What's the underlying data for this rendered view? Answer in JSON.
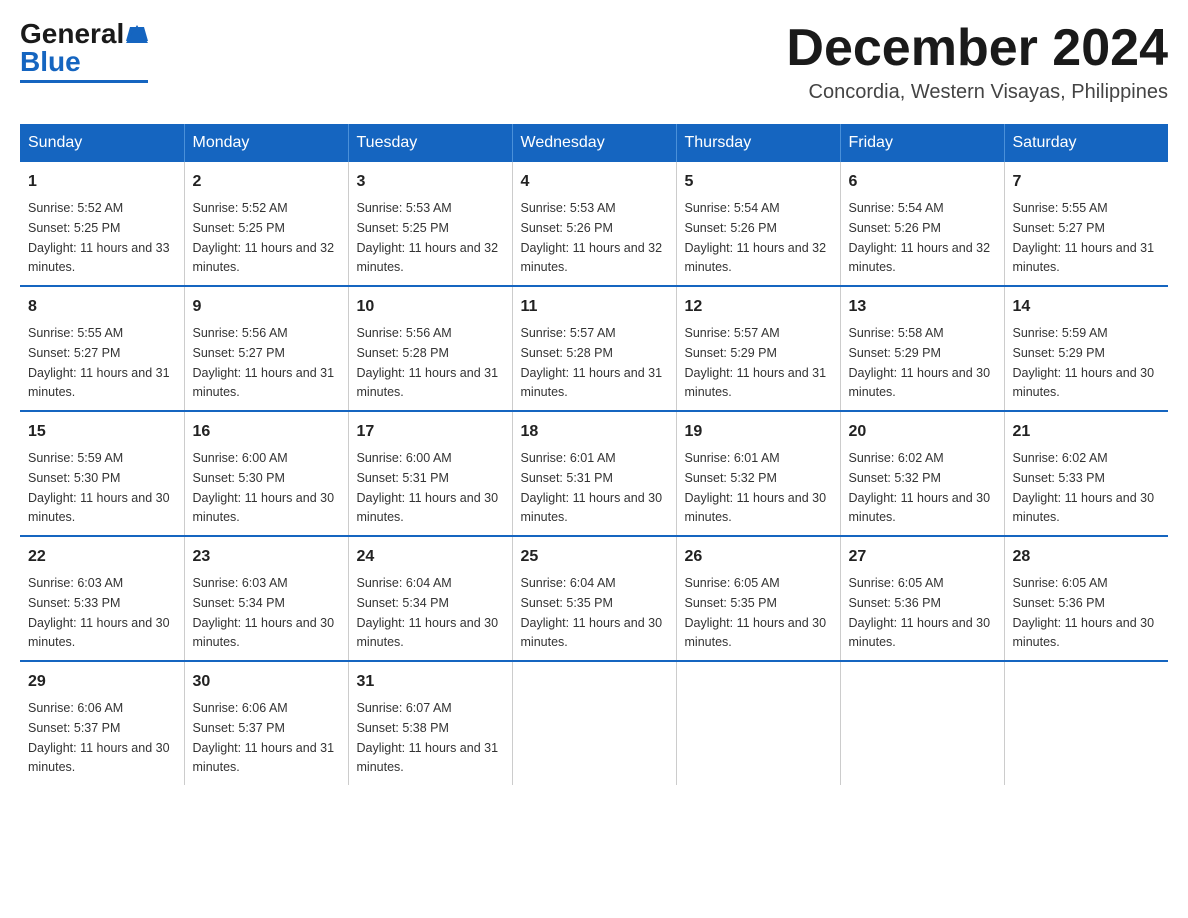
{
  "logo": {
    "general": "General",
    "blue": "Blue"
  },
  "title": "December 2024",
  "location": "Concordia, Western Visayas, Philippines",
  "header_days": [
    "Sunday",
    "Monday",
    "Tuesday",
    "Wednesday",
    "Thursday",
    "Friday",
    "Saturday"
  ],
  "weeks": [
    [
      {
        "day": "1",
        "sunrise": "5:52 AM",
        "sunset": "5:25 PM",
        "daylight": "11 hours and 33 minutes."
      },
      {
        "day": "2",
        "sunrise": "5:52 AM",
        "sunset": "5:25 PM",
        "daylight": "11 hours and 32 minutes."
      },
      {
        "day": "3",
        "sunrise": "5:53 AM",
        "sunset": "5:25 PM",
        "daylight": "11 hours and 32 minutes."
      },
      {
        "day": "4",
        "sunrise": "5:53 AM",
        "sunset": "5:26 PM",
        "daylight": "11 hours and 32 minutes."
      },
      {
        "day": "5",
        "sunrise": "5:54 AM",
        "sunset": "5:26 PM",
        "daylight": "11 hours and 32 minutes."
      },
      {
        "day": "6",
        "sunrise": "5:54 AM",
        "sunset": "5:26 PM",
        "daylight": "11 hours and 32 minutes."
      },
      {
        "day": "7",
        "sunrise": "5:55 AM",
        "sunset": "5:27 PM",
        "daylight": "11 hours and 31 minutes."
      }
    ],
    [
      {
        "day": "8",
        "sunrise": "5:55 AM",
        "sunset": "5:27 PM",
        "daylight": "11 hours and 31 minutes."
      },
      {
        "day": "9",
        "sunrise": "5:56 AM",
        "sunset": "5:27 PM",
        "daylight": "11 hours and 31 minutes."
      },
      {
        "day": "10",
        "sunrise": "5:56 AM",
        "sunset": "5:28 PM",
        "daylight": "11 hours and 31 minutes."
      },
      {
        "day": "11",
        "sunrise": "5:57 AM",
        "sunset": "5:28 PM",
        "daylight": "11 hours and 31 minutes."
      },
      {
        "day": "12",
        "sunrise": "5:57 AM",
        "sunset": "5:29 PM",
        "daylight": "11 hours and 31 minutes."
      },
      {
        "day": "13",
        "sunrise": "5:58 AM",
        "sunset": "5:29 PM",
        "daylight": "11 hours and 30 minutes."
      },
      {
        "day": "14",
        "sunrise": "5:59 AM",
        "sunset": "5:29 PM",
        "daylight": "11 hours and 30 minutes."
      }
    ],
    [
      {
        "day": "15",
        "sunrise": "5:59 AM",
        "sunset": "5:30 PM",
        "daylight": "11 hours and 30 minutes."
      },
      {
        "day": "16",
        "sunrise": "6:00 AM",
        "sunset": "5:30 PM",
        "daylight": "11 hours and 30 minutes."
      },
      {
        "day": "17",
        "sunrise": "6:00 AM",
        "sunset": "5:31 PM",
        "daylight": "11 hours and 30 minutes."
      },
      {
        "day": "18",
        "sunrise": "6:01 AM",
        "sunset": "5:31 PM",
        "daylight": "11 hours and 30 minutes."
      },
      {
        "day": "19",
        "sunrise": "6:01 AM",
        "sunset": "5:32 PM",
        "daylight": "11 hours and 30 minutes."
      },
      {
        "day": "20",
        "sunrise": "6:02 AM",
        "sunset": "5:32 PM",
        "daylight": "11 hours and 30 minutes."
      },
      {
        "day": "21",
        "sunrise": "6:02 AM",
        "sunset": "5:33 PM",
        "daylight": "11 hours and 30 minutes."
      }
    ],
    [
      {
        "day": "22",
        "sunrise": "6:03 AM",
        "sunset": "5:33 PM",
        "daylight": "11 hours and 30 minutes."
      },
      {
        "day": "23",
        "sunrise": "6:03 AM",
        "sunset": "5:34 PM",
        "daylight": "11 hours and 30 minutes."
      },
      {
        "day": "24",
        "sunrise": "6:04 AM",
        "sunset": "5:34 PM",
        "daylight": "11 hours and 30 minutes."
      },
      {
        "day": "25",
        "sunrise": "6:04 AM",
        "sunset": "5:35 PM",
        "daylight": "11 hours and 30 minutes."
      },
      {
        "day": "26",
        "sunrise": "6:05 AM",
        "sunset": "5:35 PM",
        "daylight": "11 hours and 30 minutes."
      },
      {
        "day": "27",
        "sunrise": "6:05 AM",
        "sunset": "5:36 PM",
        "daylight": "11 hours and 30 minutes."
      },
      {
        "day": "28",
        "sunrise": "6:05 AM",
        "sunset": "5:36 PM",
        "daylight": "11 hours and 30 minutes."
      }
    ],
    [
      {
        "day": "29",
        "sunrise": "6:06 AM",
        "sunset": "5:37 PM",
        "daylight": "11 hours and 30 minutes."
      },
      {
        "day": "30",
        "sunrise": "6:06 AM",
        "sunset": "5:37 PM",
        "daylight": "11 hours and 31 minutes."
      },
      {
        "day": "31",
        "sunrise": "6:07 AM",
        "sunset": "5:38 PM",
        "daylight": "11 hours and 31 minutes."
      },
      null,
      null,
      null,
      null
    ]
  ]
}
